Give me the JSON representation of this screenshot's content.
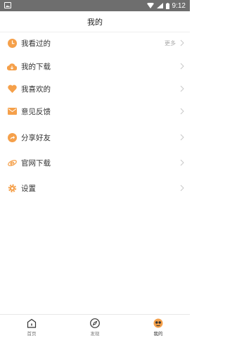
{
  "status_bar": {
    "time": "9:12"
  },
  "header": {
    "title": "我的"
  },
  "menu": {
    "items": [
      {
        "label": "我看过的",
        "more": "更多",
        "icon": "clock-icon"
      },
      {
        "label": "我的下载",
        "icon": "cloud-download-icon"
      },
      {
        "label": "我喜欢的",
        "icon": "heart-icon"
      },
      {
        "label": "意见反馈",
        "icon": "mail-icon"
      },
      {
        "label": "分享好友",
        "icon": "share-icon"
      },
      {
        "label": "官网下载",
        "icon": "ie-browser-icon"
      },
      {
        "label": "设置",
        "icon": "gear-icon"
      }
    ]
  },
  "bottom_nav": {
    "tabs": [
      {
        "label": "首页",
        "icon": "home-icon"
      },
      {
        "label": "发现",
        "icon": "compass-icon"
      },
      {
        "label": "我的",
        "icon": "profile-icon",
        "active": true
      }
    ]
  },
  "colors": {
    "accent": "#f5a04a",
    "statusbar": "#6e6e6e",
    "chevron": "#c8c8c8"
  }
}
